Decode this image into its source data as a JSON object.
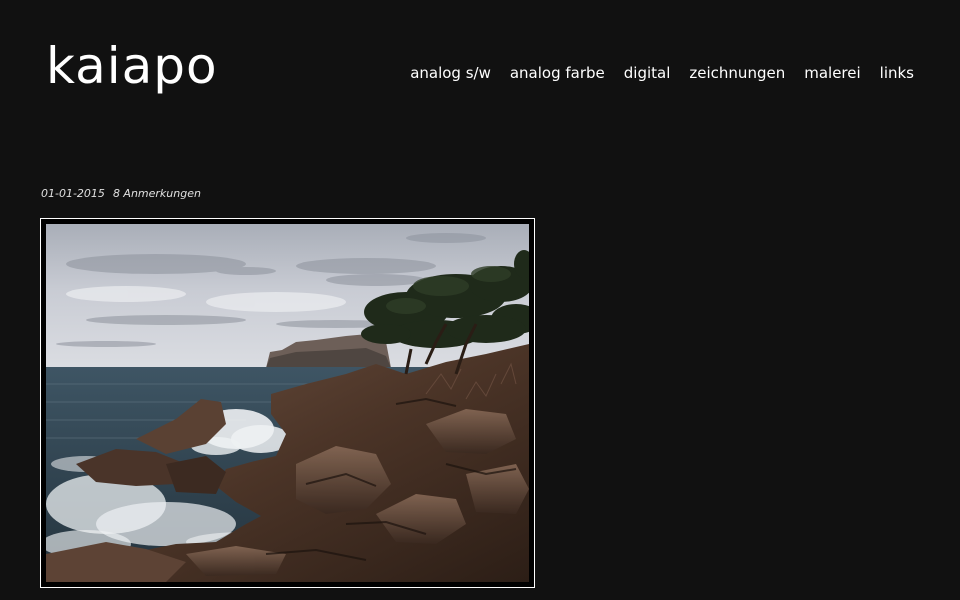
{
  "header": {
    "site_title": "kaiapo",
    "nav": [
      {
        "label": "analog s/w"
      },
      {
        "label": "analog farbe"
      },
      {
        "label": "digital"
      },
      {
        "label": "zeichnungen"
      },
      {
        "label": "malerei"
      },
      {
        "label": "links"
      }
    ]
  },
  "post": {
    "date": "01-01-2015",
    "notes": "8 Anmerkungen",
    "photo_icon": "coastal-photo"
  },
  "colors": {
    "background": "#111111",
    "text": "#ffffff",
    "frame_border": "#ffffff"
  }
}
